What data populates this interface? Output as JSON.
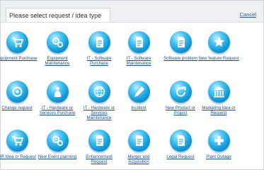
{
  "dialog": {
    "title": "Please select request / idea type",
    "cancel_label": "Cancel"
  },
  "rows": [
    [
      {
        "label": "Equipment Purchase",
        "icon": "cart-icon"
      },
      {
        "label": "Equipment Maintenance",
        "icon": "gears-icon"
      },
      {
        "label": "IT - Software Purchase",
        "icon": "document-icon"
      },
      {
        "label": "IT - Software Maintenance",
        "icon": "document-icon"
      },
      {
        "label": "Software problem",
        "icon": "document-icon"
      },
      {
        "label": "New feature Request",
        "icon": "star-icon"
      }
    ],
    [
      {
        "label": "Change request",
        "icon": "cycle-icon"
      },
      {
        "label": "IT - Hardware or Services Purchase",
        "icon": "money-bag-icon"
      },
      {
        "label": "IT - Hardware or Services Maintenance",
        "icon": "globe-icon"
      },
      {
        "label": "Incident",
        "icon": "pen-icon"
      },
      {
        "label": "New Product or Project",
        "icon": "refresh-icon"
      },
      {
        "label": "Marketing Idea or Request",
        "icon": "building-icon"
      }
    ],
    [
      {
        "label": "HR Idea or Request",
        "icon": "cart-icon"
      },
      {
        "label": "New Event planning",
        "icon": "gears-icon"
      },
      {
        "label": "Enhancement Request",
        "icon": "document-icon"
      },
      {
        "label": "Merger and Acquisition",
        "icon": "document-icon"
      },
      {
        "label": "Legal Request",
        "icon": "document-icon"
      },
      {
        "label": "Plant Outage",
        "icon": "plus-icon"
      }
    ]
  ]
}
